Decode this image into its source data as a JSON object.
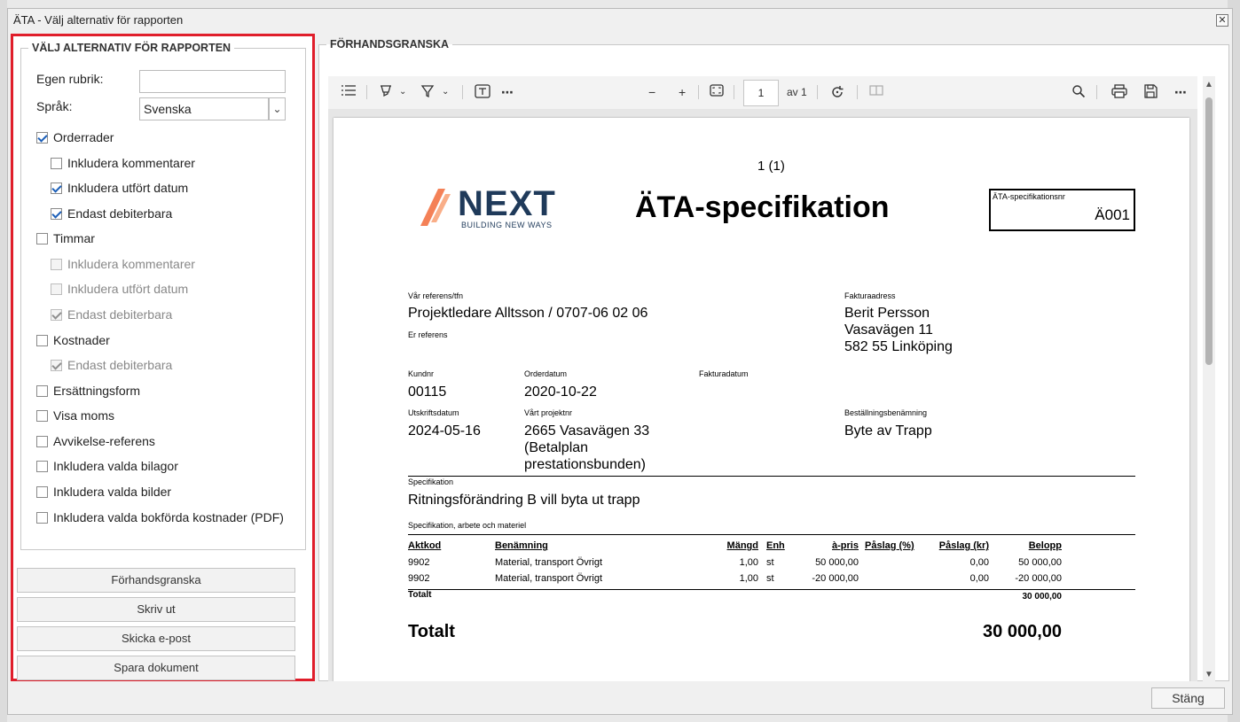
{
  "window": {
    "title": "ÄTA - Välj alternativ för rapporten",
    "close_glyph": "✕"
  },
  "options": {
    "legend": "VÄLJ ALTERNATIV FÖR RAPPORTEN",
    "custom_heading_label": "Egen rubrik:",
    "custom_heading_value": "",
    "language_label": "Språk:",
    "language_value": "Svenska",
    "checkboxes": [
      {
        "label": "Orderrader",
        "checked": true,
        "disabled": false
      },
      {
        "label": "Inkludera kommentarer",
        "checked": false,
        "disabled": false
      },
      {
        "label": "Inkludera utfört datum",
        "checked": true,
        "disabled": false
      },
      {
        "label": "Endast debiterbara",
        "checked": true,
        "disabled": false
      },
      {
        "label": "Timmar",
        "checked": false,
        "disabled": false
      },
      {
        "label": "Inkludera kommentarer",
        "checked": false,
        "disabled": true
      },
      {
        "label": "Inkludera utfört datum",
        "checked": false,
        "disabled": true
      },
      {
        "label": "Endast debiterbara",
        "checked": true,
        "disabled": true
      },
      {
        "label": "Kostnader",
        "checked": false,
        "disabled": false
      },
      {
        "label": "Endast debiterbara",
        "checked": true,
        "disabled": true
      },
      {
        "label": "Ersättningsform",
        "checked": false,
        "disabled": false
      },
      {
        "label": "Visa moms",
        "checked": false,
        "disabled": false
      },
      {
        "label": "Avvikelse-referens",
        "checked": false,
        "disabled": false
      },
      {
        "label": "Inkludera valda bilagor",
        "checked": false,
        "disabled": false
      },
      {
        "label": "Inkludera valda bilder",
        "checked": false,
        "disabled": false
      },
      {
        "label": "Inkludera valda bokförda kostnader (PDF)",
        "checked": false,
        "disabled": false
      }
    ],
    "buttons": {
      "preview": "Förhandsgranska",
      "print": "Skriv ut",
      "email": "Skicka e-post",
      "save": "Spara dokument"
    }
  },
  "preview": {
    "legend": "FÖRHANDSGRANSKA",
    "toolbar": {
      "page_number": "1",
      "page_of": "av 1"
    },
    "document": {
      "page_indicator": "1 (1)",
      "logo_text": "NEXT",
      "logo_tagline": "BUILDING NEW WAYS",
      "title": "ÄTA-specifikation",
      "spec_no_label": "ÄTA-specifikationsnr",
      "spec_no_value": "Ä001",
      "our_ref_label": "Vår referens/tfn",
      "our_ref_value": "Projektledare Alltsson / 0707-06 02 06",
      "your_ref_label": "Er referens",
      "invoice_address_label": "Fakturaadress",
      "invoice_address_lines": [
        "Berit Persson",
        "Vasavägen 11",
        "582 55 Linköping"
      ],
      "customer_no_label": "Kundnr",
      "customer_no_value": "00115",
      "order_date_label": "Orderdatum",
      "order_date_value": "2020-10-22",
      "invoice_date_label": "Fakturadatum",
      "print_date_label": "Utskriftsdatum",
      "print_date_value": "2024-05-16",
      "project_no_label": "Vårt projektnr",
      "project_no_lines": [
        "2665 Vasavägen 33",
        "(Betalplan",
        "prestationsbunden)"
      ],
      "order_name_label": "Beställningsbenämning",
      "order_name_value": "Byte av Trapp",
      "specification_label": "Specifikation",
      "specification_value": "Ritningsförändring B vill byta ut trapp",
      "spec_section_label": "Specifikation, arbete och materiel",
      "table_headers": [
        "Aktkod",
        "Benämning",
        "Mängd",
        "Enh",
        "à-pris",
        "Påslag (%)",
        "Påslag (kr)",
        "Belopp"
      ],
      "rows": [
        [
          "9902",
          "Material, transport Övrigt",
          "1,00",
          "st",
          "50 000,00",
          "",
          "0,00",
          "50 000,00"
        ],
        [
          "9902",
          "Material, transport Övrigt",
          "1,00",
          "st",
          "-20 000,00",
          "",
          "0,00",
          "-20 000,00"
        ]
      ],
      "subtotal_label": "Totalt",
      "subtotal_value": "30 000,00",
      "total_label": "Totalt",
      "total_value": "30 000,00"
    }
  },
  "footer": {
    "close_button": "Stäng"
  },
  "colors": {
    "highlight": "#e01e2b",
    "logo_navy": "#1f3a5a",
    "logo_orange": "#f26b3a"
  }
}
